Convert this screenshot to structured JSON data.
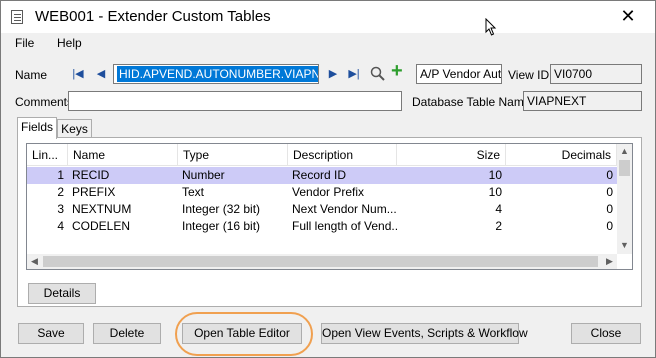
{
  "window": {
    "title": "WEB001 - Extender Custom Tables",
    "close_glyph": "✕"
  },
  "menu": {
    "items": [
      "File",
      "Help"
    ]
  },
  "form": {
    "name_label": "Name",
    "name_value": "HID.APVEND.AUTONUMBER.VIAPNEXT",
    "view_desc_value": "A/P Vendor Auto",
    "view_id_label": "View ID",
    "view_id_value": "VI0700",
    "comments_label": "Comments",
    "comments_value": "",
    "db_table_label": "Database Table Name",
    "db_table_value": "VIAPNEXT",
    "nav_first": "|◀",
    "nav_prev": "◀",
    "nav_next": "▶",
    "nav_last": "▶|",
    "zoom_glyph": "⚲",
    "new_glyph": "+"
  },
  "tabs": [
    "Fields",
    "Keys"
  ],
  "grid": {
    "columns": [
      "Lin...",
      "Name",
      "Type",
      "Description",
      "Size",
      "Decimals"
    ],
    "rows": [
      {
        "line": "1",
        "name": "RECID",
        "type": "Number",
        "description": "Record ID",
        "size": "10",
        "decimals": "0"
      },
      {
        "line": "2",
        "name": "PREFIX",
        "type": "Text",
        "description": "Vendor Prefix",
        "size": "10",
        "decimals": "0"
      },
      {
        "line": "3",
        "name": "NEXTNUM",
        "type": "Integer (32 bit)",
        "description": "Next Vendor Num...",
        "size": "4",
        "decimals": "0"
      },
      {
        "line": "4",
        "name": "CODELEN",
        "type": "Integer (16 bit)",
        "description": "Full length of Vend...",
        "size": "2",
        "decimals": "0"
      }
    ]
  },
  "buttons": {
    "details": "Details",
    "save": "Save",
    "delete": "Delete",
    "open_table_editor": "Open Table Editor",
    "open_view_events": "Open View Events, Scripts & Workflow",
    "close": "Close"
  },
  "colors": {
    "selected_row": "#cdcbf7",
    "selection_highlight": "#0078d7",
    "annotation_ring": "#f0a050",
    "nav_arrow": "#1e4e9c",
    "new_plus": "#2e9e2e"
  }
}
